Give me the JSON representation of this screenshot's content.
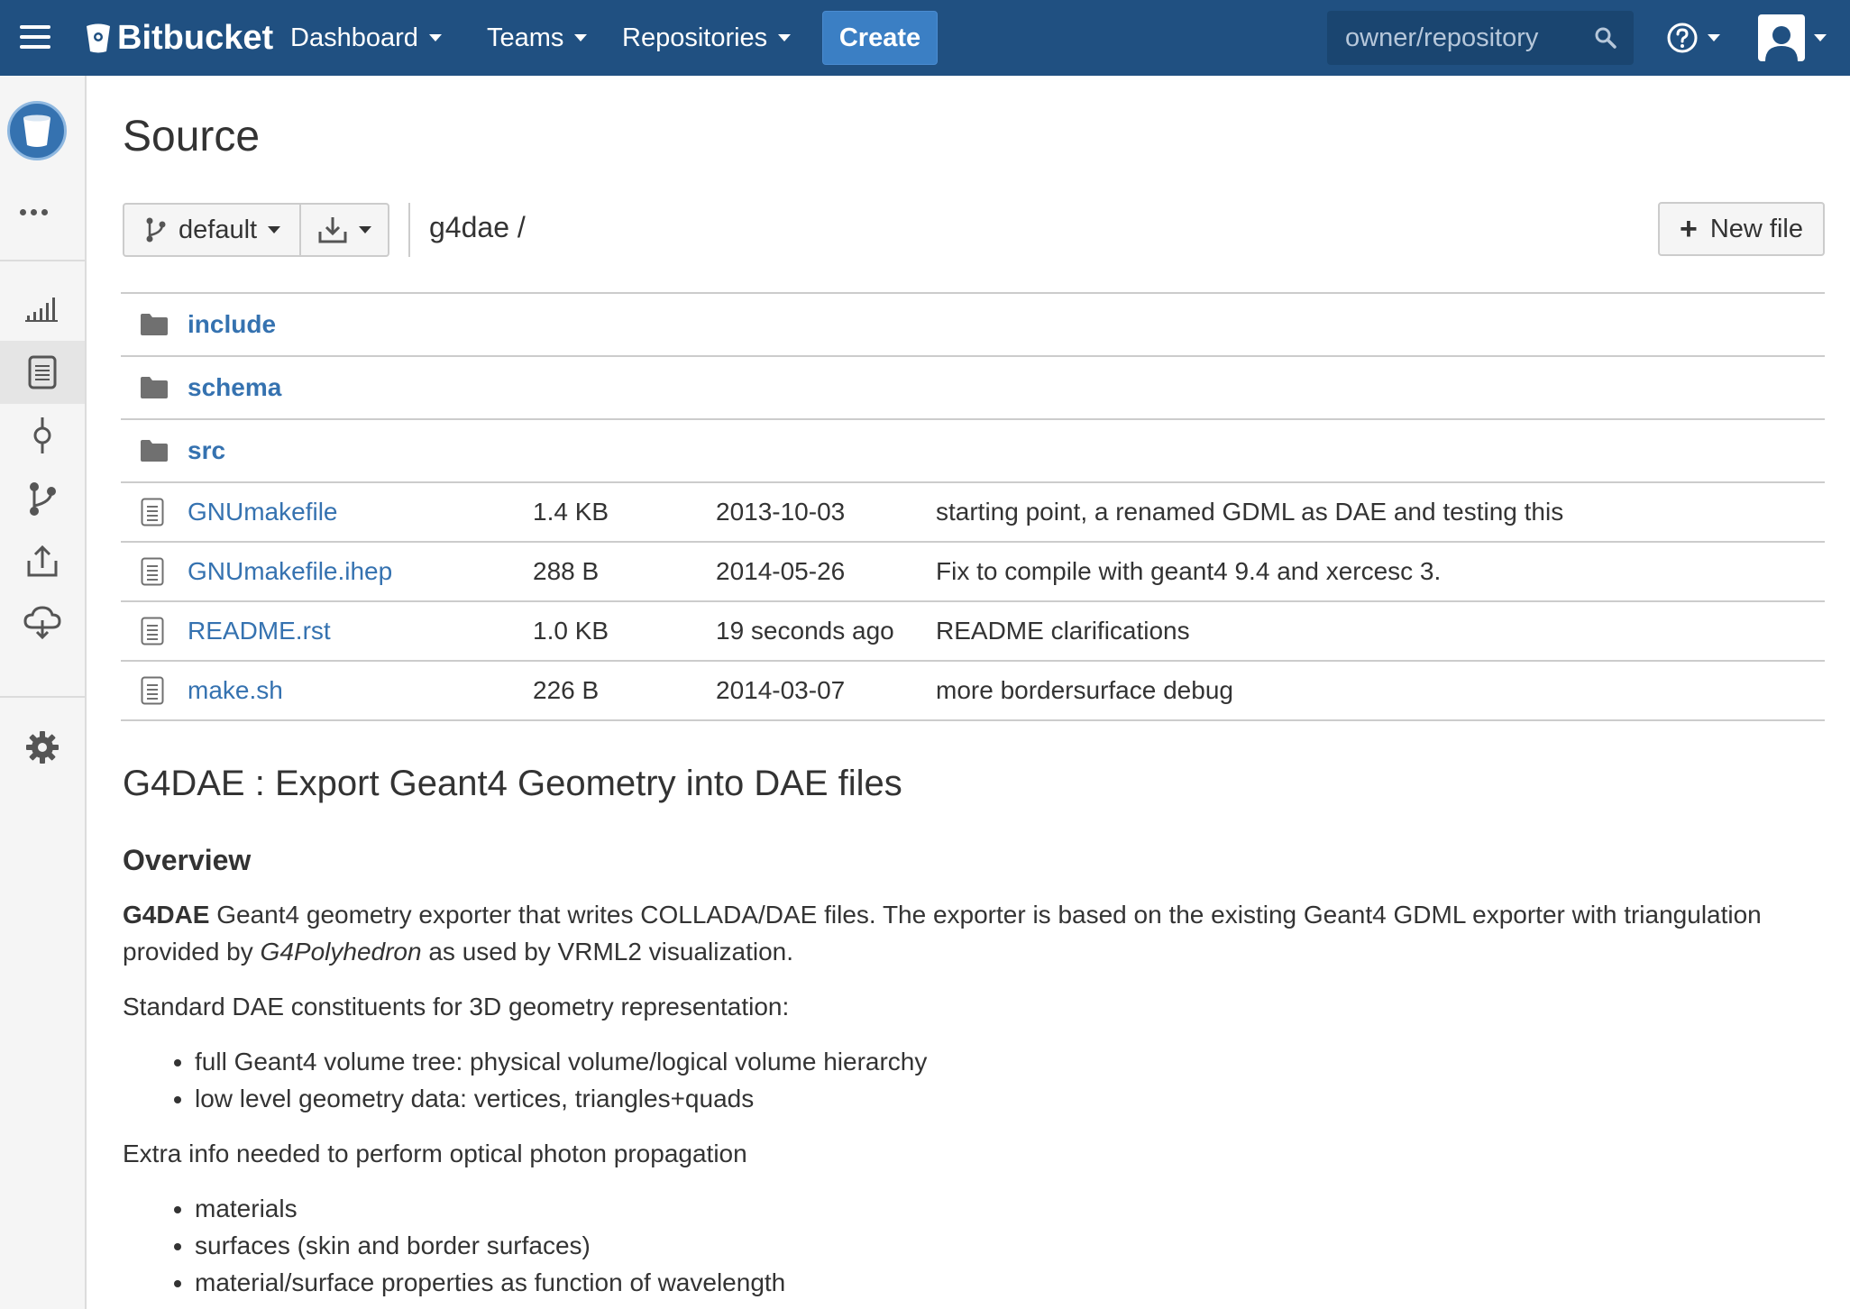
{
  "header": {
    "logo_text": "Bitbucket",
    "nav": [
      {
        "label": "Dashboard"
      },
      {
        "label": "Teams"
      },
      {
        "label": "Repositories"
      }
    ],
    "create_label": "Create",
    "search_placeholder": "owner/repository"
  },
  "sidebar": {
    "items": [
      "overview-icon",
      "source-icon",
      "commits-icon",
      "branches-icon",
      "pull-requests-icon",
      "downloads-icon",
      "settings-icon"
    ],
    "active": "source-icon"
  },
  "main": {
    "title": "Source",
    "branch": "default",
    "breadcrumb": "g4dae /",
    "new_file_label": "New file",
    "dirs": [
      {
        "name": "include"
      },
      {
        "name": "schema"
      },
      {
        "name": "src"
      }
    ],
    "files": [
      {
        "name": "GNUmakefile",
        "size": "1.4 KB",
        "date": "2013-10-03",
        "message": "starting point, a renamed GDML as DAE and testing this"
      },
      {
        "name": "GNUmakefile.ihep",
        "size": "288 B",
        "date": "2014-05-26",
        "message": "Fix to compile with geant4 9.4 and xercesc 3."
      },
      {
        "name": "README.rst",
        "size": "1.0 KB",
        "date": "19 seconds ago",
        "message": "README clarifications"
      },
      {
        "name": "make.sh",
        "size": "226 B",
        "date": "2014-03-07",
        "message": "more bordersurface debug"
      }
    ]
  },
  "readme": {
    "title": "G4DAE : Export Geant4 Geometry into DAE files",
    "overview_heading": "Overview",
    "p1_bold": "G4DAE",
    "p1_text": " Geant4 geometry exporter that writes COLLADA/DAE files. The exporter is based on the existing Geant4 GDML exporter with triangulation provided by ",
    "p1_italic": "G4Polyhedron",
    "p1_tail": " as used by VRML2 visualization.",
    "p2": "Standard DAE constituents for 3D geometry representation:",
    "list1": [
      "full Geant4 volume tree: physical volume/logical volume hierarchy",
      "low level geometry data: vertices, triangles+quads"
    ],
    "p3": "Extra info needed to perform optical photon propagation",
    "list2": [
      "materials",
      "surfaces (skin and border surfaces)",
      "material/surface properties as function of wavelength"
    ]
  },
  "colors": {
    "header_bg": "#205081",
    "link": "#3572b0",
    "create_btn": "#3b7fc4"
  }
}
